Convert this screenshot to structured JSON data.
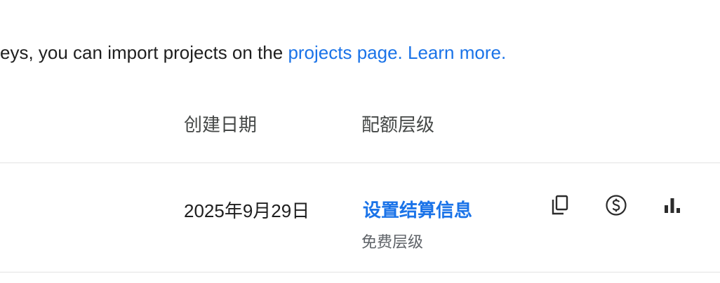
{
  "intro": {
    "text": "eys, you can import projects on the ",
    "link_projects": "projects page.",
    "link_learn": "Learn more."
  },
  "table": {
    "headers": {
      "created": "创建日期",
      "tier": "配额层级"
    },
    "rows": [
      {
        "created": "2025年9月29日",
        "billing_action": "设置结算信息",
        "tier": "免费层级",
        "icons": [
          "copy-icon",
          "billing-icon",
          "usage-icon"
        ]
      }
    ]
  },
  "colors": {
    "link": "#1a73e8",
    "text": "#1f1f1f",
    "muted": "#5f6368",
    "divider": "#e3e3e3"
  }
}
